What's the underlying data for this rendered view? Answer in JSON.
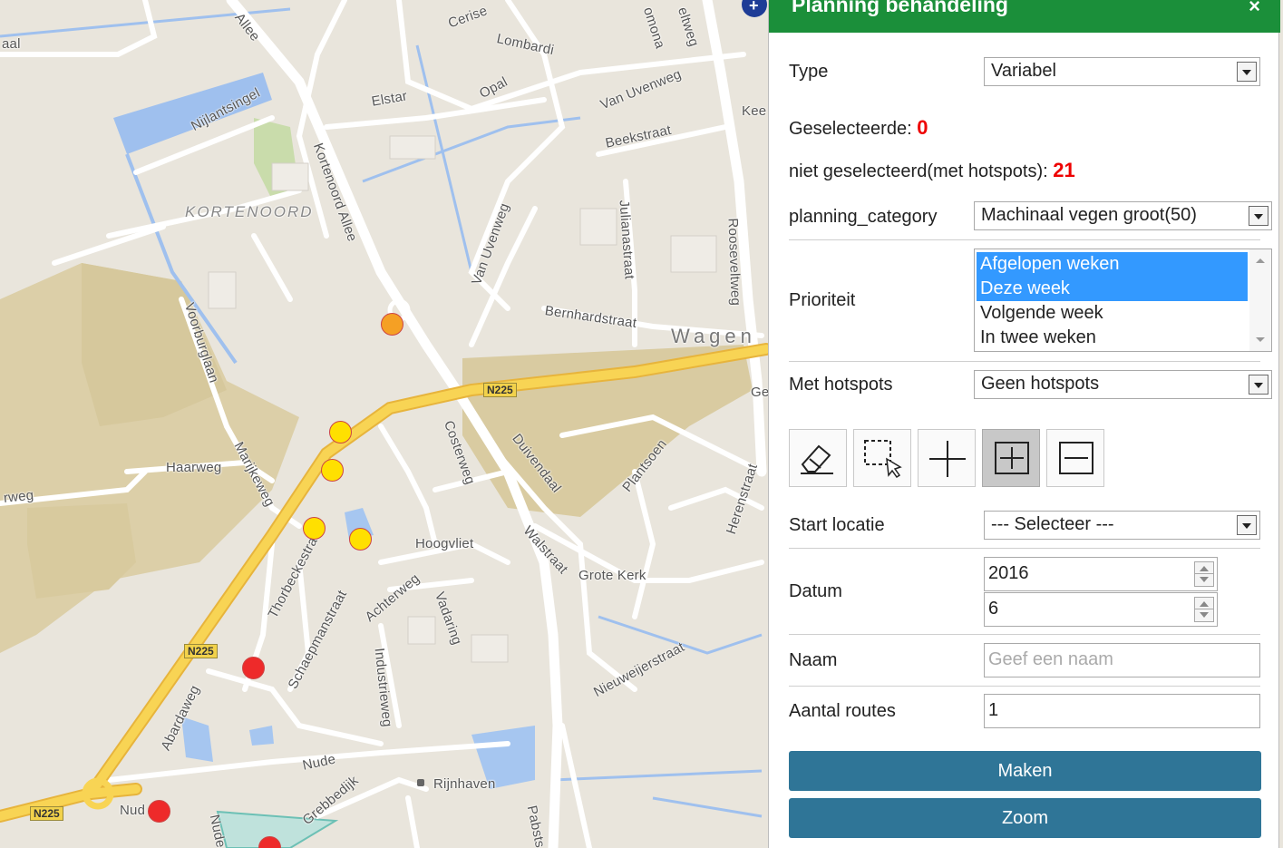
{
  "map": {
    "street_labels": [
      "aal",
      "Allee",
      "Cerise",
      "Lombardi",
      "omona",
      "eltweg",
      "Nijlantsingel",
      "Elstar",
      "Opal",
      "Van Uvenweg",
      "Kee",
      "Kortenoord Allee",
      "Beekstraat",
      "Van Uvenweg",
      "Julianastraat",
      "Rooseveltweg",
      "Voorburglaan",
      "Bernhardstraat",
      "Ge",
      "Costerweg",
      "Duivendaal",
      "Plantsoen",
      "Haarweg",
      "Marijkeweg",
      "rweg",
      "Herenstraat",
      "Thorbeckestraat",
      "Hoogvliet",
      "Walstraat",
      "Achterweg",
      "Vadaring",
      "Grote Kerk",
      "Schaepmanstraat",
      "Industrieweg",
      "Abardaweg",
      "Nieuweijerstraat",
      "Nude",
      "Grebbedijk",
      "Rijnhaven",
      "Nud",
      "Pabsts",
      "Nude"
    ],
    "area_labels": [
      "KORTENOORD"
    ],
    "city_label": "Wagen",
    "road_shields": [
      "N225",
      "N225",
      "N225"
    ],
    "hotspot_colors": {
      "orange": "#f5a024",
      "yellow": "#ffe000",
      "red": "#ee2a2a"
    }
  },
  "panel": {
    "title": "Planning behandeling",
    "close_label": "×",
    "type_label": "Type",
    "type_value": "Variabel",
    "selected_label": "Geselecteerde:",
    "selected_count": "0",
    "unselected_label": "niet geselecteerd(met hotspots):",
    "unselected_count": "21",
    "category_label": "planning_category",
    "category_value": "Machinaal vegen groot(50)",
    "priority_label": "Prioriteit",
    "priority_options": [
      {
        "label": "Afgelopen weken",
        "selected": true
      },
      {
        "label": "Deze week",
        "selected": true
      },
      {
        "label": "Volgende week",
        "selected": false
      },
      {
        "label": "In twee weken",
        "selected": false
      }
    ],
    "hotspots_label": "Met hotspots",
    "hotspots_value": "Geen hotspots",
    "tools": [
      "eraser-icon",
      "select-area-icon",
      "add-point-icon",
      "add-box-icon",
      "remove-box-icon"
    ],
    "active_tool": "add-box-icon",
    "start_label": "Start locatie",
    "start_value": "--- Selecteer ---",
    "date_label": "Datum",
    "date_year": "2016",
    "date_week": "6",
    "name_label": "Naam",
    "name_placeholder": "Geef een naam",
    "routes_label": "Aantal routes",
    "routes_value": "1",
    "make_button": "Maken",
    "zoom_button": "Zoom"
  }
}
